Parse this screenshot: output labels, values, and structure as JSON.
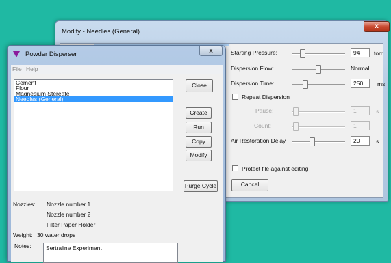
{
  "modify_window": {
    "title": "Modify - Needles (General)",
    "close_glyph": "x",
    "fields": {
      "starting_pressure": {
        "label": "Starting Pressure:",
        "value": "94",
        "unit": "torr"
      },
      "dispersion_flow": {
        "label": "Dispersion Flow:",
        "value": "Normal"
      },
      "dispersion_time": {
        "label": "Dispersion Time:",
        "value": "250",
        "unit": "ms"
      },
      "repeat_dispersion": {
        "label": "Repeat Dispersion",
        "checked": false
      },
      "pause": {
        "label": "Pause:",
        "value": "1",
        "unit": "s",
        "enabled": false
      },
      "count": {
        "label": "Count:",
        "value": "1",
        "enabled": false
      },
      "air_restoration_delay": {
        "label": "Air Restoration Delay",
        "value": "20",
        "unit": "s"
      },
      "protect_file": {
        "label": "Protect file against editing",
        "checked": false
      }
    },
    "cancel_label": "Cancel"
  },
  "powder_window": {
    "title": "Powder Disperser",
    "close_glyph": "x",
    "menu": [
      "File",
      "Help"
    ],
    "recipes": [
      "Cement",
      "Flour",
      "Magnesium Stereate",
      "Needles (General)"
    ],
    "selected_recipe": "Needles (General)",
    "buttons": {
      "close": "Close",
      "create": "Create",
      "run": "Run",
      "copy": "Copy",
      "modify": "Modify",
      "purge": "Purge Cycle"
    },
    "info": {
      "nozzles_label": "Nozzles:",
      "nozzles": [
        "Nozzle number 1",
        "Nozzle number 2",
        "Filter Paper Holder"
      ],
      "weight_label": "Weight:",
      "weight": "30 water drops",
      "notes_label": "Notes:",
      "notes": "Sertraline Experiment"
    }
  }
}
